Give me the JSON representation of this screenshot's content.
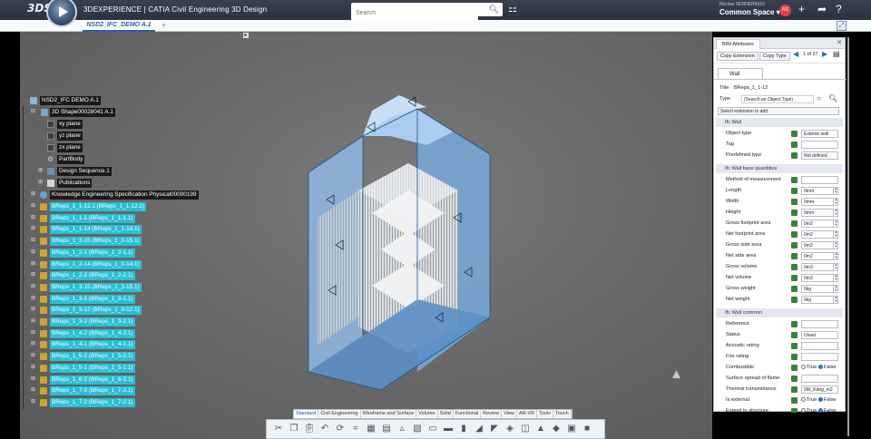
{
  "topbar": {
    "brand_mark": "3DS",
    "title_prefix": "3DEXPERIENCE | CATIA ",
    "title_bold": "Civil Engineering 3D Design",
    "search_placeholder": "Search",
    "user": "Nicolas SENNERMUD",
    "space": "Common Space",
    "avatar": "NS",
    "colors": {
      "bar": "#2f3744",
      "accent": "#2b5fa6"
    }
  },
  "tabs": [
    {
      "label": "NSD2_IFC_DEMO A.1"
    }
  ],
  "tree": {
    "root": "NSD2_IFC DEMO A.1",
    "shape": "3D Shape00028041 A.1",
    "planes": [
      "xy plane",
      "yz plane",
      "zx plane"
    ],
    "part_body": "PartBody",
    "design_seq": "Design Sequence.1",
    "publications": "Publications",
    "knowledge": "Knowledge Engineering Specification Physical00000199",
    "breps": [
      "BReps_1_1-12.1 (BReps_1_1-12.1)",
      "BReps_1_1-1 (BReps_1_1-1.1)",
      "BReps_1_1-14 (BReps_1_1-14.1)",
      "BReps_1_2-15 (BReps_1_2-15.1)",
      "BReps_1_2-1 (BReps_1_2-1.1)",
      "BReps_1_2-14 (BReps_1_2-14.1)",
      "BReps_1_2-2 (BReps_1_2-2.1)",
      "BReps_1_3-15 (BReps_1_3-15.1)",
      "BReps_1_3-1 (BReps_1_3-1.1)",
      "BReps_1_3-12 (BReps_1_3-12.1)",
      "BReps_1_3-2 (BReps_1_3-2.1)",
      "BReps_1_4-2 (BReps_1_4-2.1)",
      "BReps_1_4-1 (BReps_1_4-1.1)",
      "BReps_1_5-2 (BReps_1_5-2.1)",
      "BReps_1_5-1 (BReps_1_5-1.1)",
      "BReps_1_6-2 (BReps_1_6-2.1)",
      "BReps_1_7-3 (BReps_1_7-3.1)",
      "BReps_1_7-2 (BReps_1_7-2.1)"
    ]
  },
  "toolbar": {
    "tabs": [
      "Standard",
      "Civil Engineering",
      "Wireframe and Surface",
      "Volume",
      "Solid",
      "Functional",
      "Review",
      "View",
      "AR-VR",
      "Tools",
      "Touch"
    ],
    "active": "Standard"
  },
  "panel": {
    "header": "BIM Attributes",
    "copy_extension": "Copy Extension",
    "copy_type": "Copy Type",
    "page": "1 of 27",
    "wall_tab": "Wall",
    "title_label": "Title",
    "title_value": "BReps_1_1-12",
    "type_label": "Type",
    "type_value": "(Search an Object Type)",
    "select_extension": "Select extension to add",
    "section_wall": "Ifc Wall",
    "wall_rows": [
      {
        "label": "Object type",
        "value": "Exterior wall"
      },
      {
        "label": "Tag",
        "value": ""
      },
      {
        "label": "Predefined type",
        "value": "Not defined"
      }
    ],
    "section_quant": "Ifc Wall base quantities",
    "quant_rows": [
      {
        "label": "Method of measurement",
        "value": ""
      },
      {
        "label": "Length",
        "value": "0mm"
      },
      {
        "label": "Width",
        "value": "0mm"
      },
      {
        "label": "Height",
        "value": "0mm"
      },
      {
        "label": "Gross footprint area",
        "value": "0m2"
      },
      {
        "label": "Net footprint area",
        "value": "0m2"
      },
      {
        "label": "Gross side area",
        "value": "0m2"
      },
      {
        "label": "Net side area",
        "value": "0m2"
      },
      {
        "label": "Gross volume",
        "value": "0m3"
      },
      {
        "label": "Net volume",
        "value": "0m3"
      },
      {
        "label": "Gross weight",
        "value": "0kg"
      },
      {
        "label": "Net weight",
        "value": "0kg"
      }
    ],
    "section_common": "Ifc Wall common",
    "common_rows": [
      {
        "label": "Reference",
        "value": ""
      },
      {
        "label": "Status",
        "value": "Unset"
      },
      {
        "label": "Acoustic rating",
        "value": ""
      },
      {
        "label": "Fire rating",
        "value": ""
      },
      {
        "label": "Combustible",
        "value": ""
      },
      {
        "label": "Surface spread of flame",
        "value": ""
      },
      {
        "label": "Thermal transmittance",
        "value": "0W_Kdeg_m2"
      },
      {
        "label": "Is external",
        "value": ""
      },
      {
        "label": "Extend to structure",
        "value": ""
      }
    ],
    "true_label": "True",
    "false_label": "False"
  }
}
